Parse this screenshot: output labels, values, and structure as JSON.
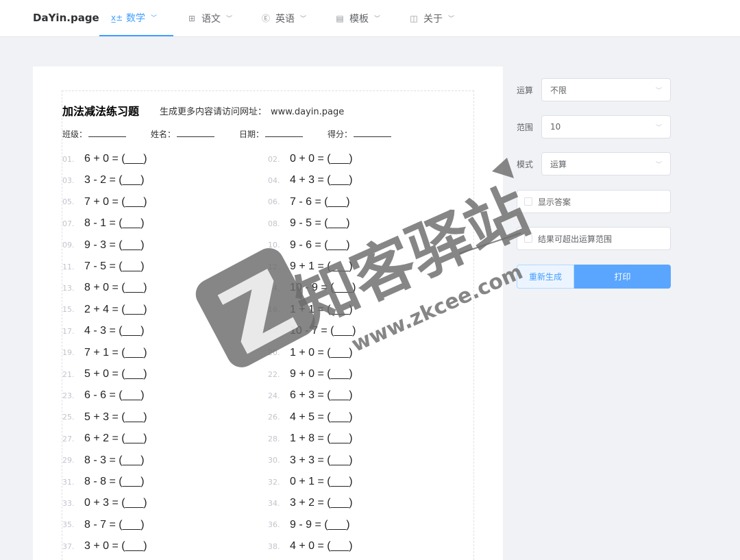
{
  "nav": {
    "brand": "DaYin.page",
    "items": [
      {
        "icon": "formula-icon",
        "glyph": "x̲±",
        "label": "数学",
        "active": true
      },
      {
        "icon": "chinese-icon",
        "glyph": "⊞",
        "label": "语文",
        "active": false
      },
      {
        "icon": "english-icon",
        "glyph": "Ⓔ",
        "label": "英语",
        "active": false
      },
      {
        "icon": "template-icon",
        "glyph": "▤",
        "label": "模板",
        "active": false
      },
      {
        "icon": "about-icon",
        "glyph": "◫",
        "label": "关于",
        "active": false
      }
    ]
  },
  "worksheet": {
    "title": "加法减法练习题",
    "subtitle": "生成更多内容请访问网址：",
    "url": "www.dayin.page",
    "fields": [
      "班级：",
      "姓名：",
      "日期：",
      "得分："
    ],
    "problems": [
      {
        "n": "01.",
        "e": "6 + 0 = (___)"
      },
      {
        "n": "02.",
        "e": "0 + 0 = (___)"
      },
      {
        "n": "03.",
        "e": "3 - 2 = (___)"
      },
      {
        "n": "04.",
        "e": "4 + 3 = (___)"
      },
      {
        "n": "05.",
        "e": "7 + 0 = (___)"
      },
      {
        "n": "06.",
        "e": "7 - 6 = (___)"
      },
      {
        "n": "07.",
        "e": "8 - 1 = (___)"
      },
      {
        "n": "08.",
        "e": "9 - 5 = (___)"
      },
      {
        "n": "09.",
        "e": "9 - 3 = (___)"
      },
      {
        "n": "10.",
        "e": "9 - 6 = (___)"
      },
      {
        "n": "11.",
        "e": "7 - 5 = (___)"
      },
      {
        "n": "12.",
        "e": "9 + 1 = (___)"
      },
      {
        "n": "13.",
        "e": "8 + 0 = (___)"
      },
      {
        "n": "14.",
        "e": "10 - 9 = (___)"
      },
      {
        "n": "15.",
        "e": "2 + 4 = (___)"
      },
      {
        "n": "16.",
        "e": "1 + 1 = (___)"
      },
      {
        "n": "17.",
        "e": "4 - 3 = (___)"
      },
      {
        "n": "18.",
        "e": "10 - 7 = (___)"
      },
      {
        "n": "19.",
        "e": "7 + 1 = (___)"
      },
      {
        "n": "20.",
        "e": "1 + 0 = (___)"
      },
      {
        "n": "21.",
        "e": "5 + 0 = (___)"
      },
      {
        "n": "22.",
        "e": "9 + 0 = (___)"
      },
      {
        "n": "23.",
        "e": "6 - 6 = (___)"
      },
      {
        "n": "24.",
        "e": "6 + 3 = (___)"
      },
      {
        "n": "25.",
        "e": "5 + 3 = (___)"
      },
      {
        "n": "26.",
        "e": "4 + 5 = (___)"
      },
      {
        "n": "27.",
        "e": "6 + 2 = (___)"
      },
      {
        "n": "28.",
        "e": "1 + 8 = (___)"
      },
      {
        "n": "29.",
        "e": "8 - 3 = (___)"
      },
      {
        "n": "30.",
        "e": "3 + 3 = (___)"
      },
      {
        "n": "31.",
        "e": "8 - 8 = (___)"
      },
      {
        "n": "32.",
        "e": "0 + 1 = (___)"
      },
      {
        "n": "33.",
        "e": "0 + 3 = (___)"
      },
      {
        "n": "34.",
        "e": "3 + 2 = (___)"
      },
      {
        "n": "35.",
        "e": "8 - 7 = (___)"
      },
      {
        "n": "36.",
        "e": "9 - 9 = (___)"
      },
      {
        "n": "37.",
        "e": "3 + 0 = (___)"
      },
      {
        "n": "38.",
        "e": "4 + 0 = (___)"
      }
    ]
  },
  "panel": {
    "operation": {
      "label": "运算",
      "value": "不限"
    },
    "range": {
      "label": "范围",
      "value": "10"
    },
    "mode": {
      "label": "模式",
      "value": "运算"
    },
    "show_answer": "显示答案",
    "exceed_range": "结果可超出运算范围",
    "regenerate": "重新生成",
    "print": "打印"
  },
  "watermark": {
    "text": "知客驿站",
    "url": "www.zkcee.com"
  },
  "colors": {
    "accent": "#409eff",
    "print_button": "#5aa6ff",
    "watermark": "#6b6b6b"
  }
}
